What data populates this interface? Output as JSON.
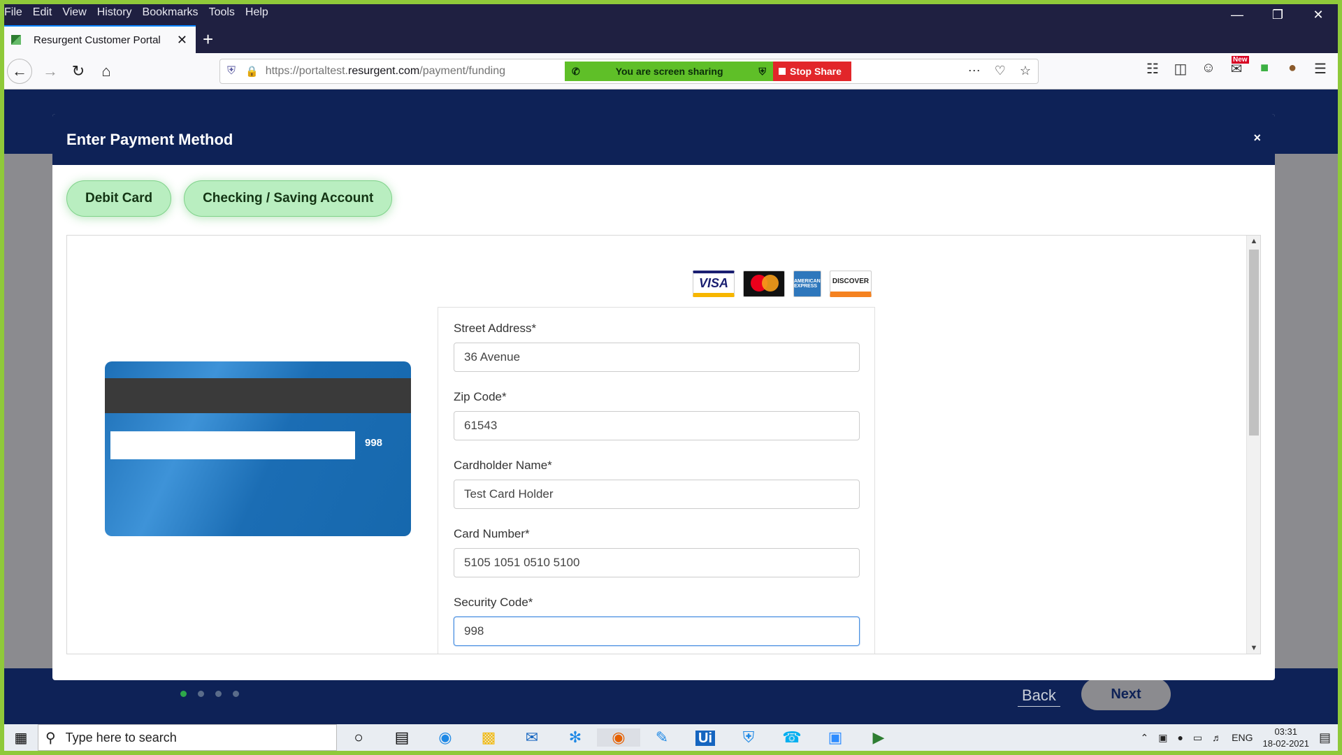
{
  "browser": {
    "menu": [
      "File",
      "Edit",
      "View",
      "History",
      "Bookmarks",
      "Tools",
      "Help"
    ],
    "tab_title": "Resurgent Customer Portal",
    "url_prefix": "https://portaltest.",
    "url_domain": "resurgent.com",
    "url_path": "/payment/funding",
    "share_message": "You are screen sharing",
    "stop_share": "Stop Share",
    "new_badge": "New"
  },
  "modal": {
    "title": "Enter Payment Method",
    "close": "×",
    "tabs": [
      "Debit Card",
      "Checking / Saving Account"
    ]
  },
  "card_preview": {
    "cvv": "998"
  },
  "logos": [
    "VISA",
    "mastercard",
    "AMERICAN EXPRESS",
    "DISCOVER"
  ],
  "form": {
    "fields": [
      {
        "label": "Street Address*",
        "value": "36 Avenue"
      },
      {
        "label": "Zip Code*",
        "value": "61543"
      },
      {
        "label": "Cardholder Name*",
        "value": "Test Card Holder"
      },
      {
        "label": "Card Number*",
        "value": "5105 1051 0510 5100"
      },
      {
        "label": "Security Code*",
        "value": "998"
      }
    ]
  },
  "footer": {
    "back": "Back",
    "next": "Next",
    "step_count": 4,
    "active_step": 1
  },
  "taskbar": {
    "search_placeholder": "Type here to search",
    "lang": "ENG",
    "time": "03:31",
    "date": "18-02-2021"
  },
  "colors": {
    "navy": "#0e2257",
    "pill_green": "#b9eec0",
    "share_green": "#5fbf28",
    "share_red": "#e2262a"
  }
}
